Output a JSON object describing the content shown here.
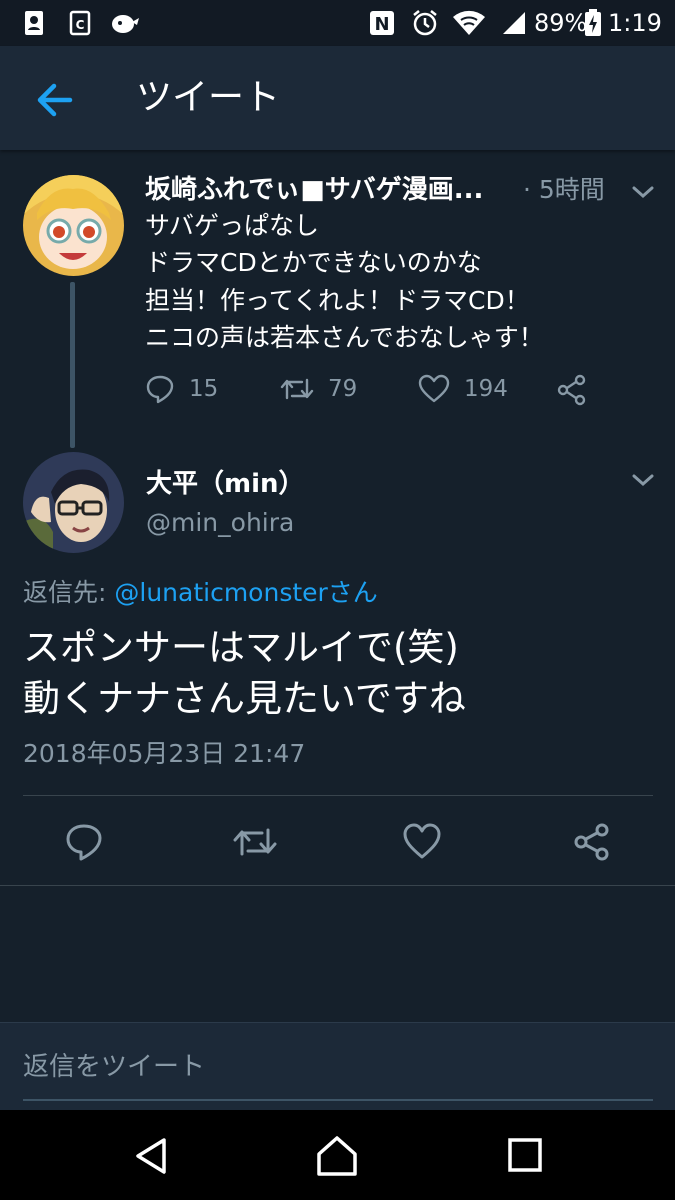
{
  "status_bar": {
    "battery_percent": "89%",
    "time": "1:19",
    "icons": [
      "contacts-icon",
      "calendar-icon",
      "cat-icon",
      "nfc-icon",
      "alarm-icon",
      "wifi-icon",
      "signal-icon",
      "battery-icon"
    ]
  },
  "toolbar": {
    "back_icon": "arrow-left-icon",
    "title": "ツイート"
  },
  "parent_tweet": {
    "display_name": "坂崎ふれでぃ■サバゲ漫画...",
    "time": "· 5時間",
    "lines": [
      "サバゲっぱなし",
      "ドラマCDとかできないのかな",
      "担当！作ってくれよ！ドラマCD！",
      "ニコの声は若本さんでおなしゃす！"
    ],
    "actions": {
      "reply_count": "15",
      "retweet_count": "79",
      "like_count": "194"
    }
  },
  "main_tweet": {
    "display_name": "大平（min）",
    "handle": "@min_ohira",
    "reply_to_prefix": "返信先: ",
    "reply_to_mention": "@lunaticmonsterさん",
    "lines": [
      "スポンサーはマルイで(笑)",
      "動くナナさん見たいですね"
    ],
    "date": "2018年05月23日 21:47"
  },
  "reply_box": {
    "placeholder": "返信をツイート"
  },
  "colors": {
    "background": "#15202b",
    "toolbar": "#1c2938",
    "accent": "#1da1f2",
    "secondary_text": "#8899a6"
  }
}
